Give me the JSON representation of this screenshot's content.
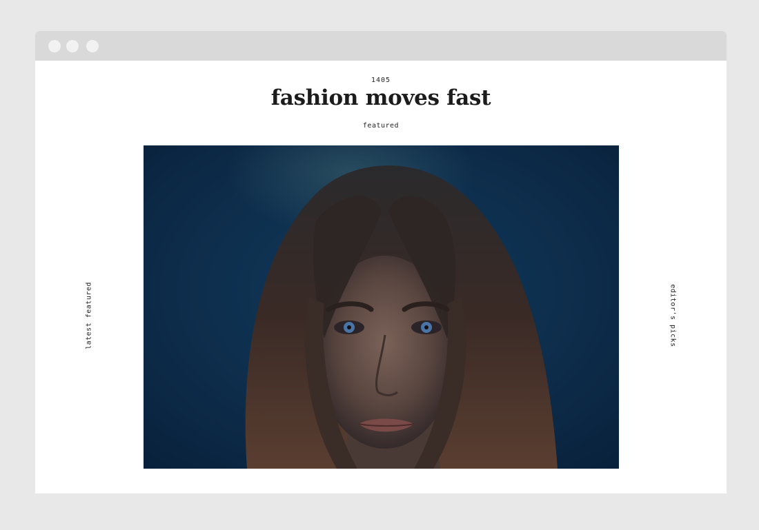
{
  "article": {
    "issue_number": "1405",
    "title": "fashion moves fast",
    "category": "featured"
  },
  "side_nav": {
    "left_label": "latest featured",
    "right_label": "editor's picks"
  }
}
